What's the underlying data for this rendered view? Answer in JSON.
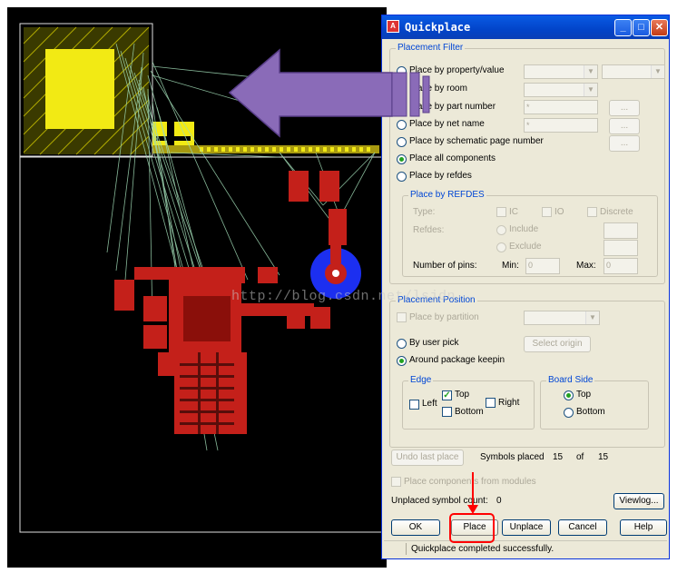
{
  "watermark": "http://blog.csdn.net/lsjdn",
  "dialog": {
    "title": "Quickplace",
    "placement_filter": {
      "title": "Placement Filter",
      "options": [
        "Place by property/value",
        "Place by room",
        "Place by part number",
        "Place by net name",
        "Place by schematic page number",
        "Place all components",
        "Place by refdes"
      ],
      "selected": "Place all components",
      "part_number_value": "*",
      "net_name_value": "*",
      "browse_label": "..."
    },
    "refdes": {
      "title": "Place by REFDES",
      "type_label": "Type:",
      "ic_label": "IC",
      "io_label": "IO",
      "discrete_label": "Discrete",
      "refdes_label": "Refdes:",
      "include_label": "Include",
      "exclude_label": "Exclude",
      "pins_label": "Number of pins:",
      "min_label": "Min:",
      "min_value": "0",
      "max_label": "Max:",
      "max_value": "0"
    },
    "placement_position": {
      "title": "Placement Position",
      "by_partition": "Place by partition",
      "by_user_pick": "By user pick",
      "select_origin": "Select origin",
      "around_keepin": "Around package keepin",
      "selected": "Around package keepin"
    },
    "edge": {
      "title": "Edge",
      "left": "Left",
      "top": "Top",
      "right": "Right",
      "bottom": "Bottom",
      "checked": [
        "Top"
      ]
    },
    "board_side": {
      "title": "Board Side",
      "top": "Top",
      "bottom": "Bottom",
      "selected": "Top"
    },
    "undo_last_place": "Undo last place",
    "symbols_placed_label": "Symbols placed",
    "symbols_placed": "15",
    "of_label": "of",
    "symbols_total": "15",
    "place_from_modules": "Place components from modules",
    "unplaced_label": "Unplaced symbol count:",
    "unplaced_count": "0",
    "viewlog": "Viewlog...",
    "buttons": {
      "ok": "OK",
      "place": "Place",
      "unplace": "Unplace",
      "cancel": "Cancel",
      "help": "Help"
    },
    "status": "Quickplace completed successfully."
  },
  "colors": {
    "canvas": "#000000",
    "arrow": "#8a6bb8",
    "highlight": "#ff0000",
    "copper": "#c4201a",
    "pad_yellow": "#f2ea14",
    "ratsnest": "#9fd9b4"
  }
}
